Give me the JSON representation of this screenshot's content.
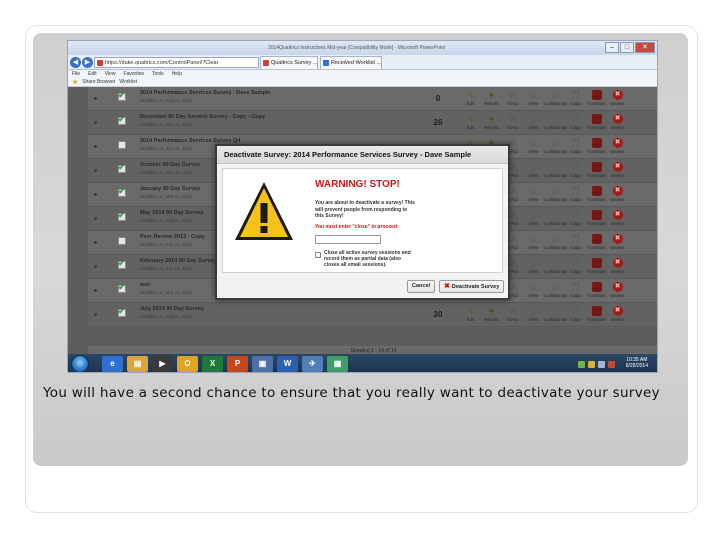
{
  "browser": {
    "window_title": "2014Qualtrics Instructions Mid-year [Compatibility Mode] - Microsoft PowerPoint",
    "address": "https://duke.qualtrics.com/ControlPanel/?Clear",
    "tabs": [
      "Qualtrics Survey ...",
      "Received Worklist ..."
    ],
    "menu": [
      "File",
      "Edit",
      "View",
      "Favorites",
      "Tools",
      "Help"
    ],
    "favorites": [
      "Share Browser",
      "Worklist"
    ]
  },
  "surveys": [
    {
      "name": "2014 Performance Services Survey - Dave Sample",
      "sub": "Modified on: Aug 01, 2014",
      "count": "0",
      "checked": true
    },
    {
      "name": "December 90 Day Generic Survey - Copy - Copy",
      "sub": "Modified on: Mar 11, 2014",
      "count": "26",
      "checked": true
    },
    {
      "name": "2014 Performance Services Survey Q4",
      "sub": "Modified on: Jan 09, 2014",
      "count": "",
      "checked": false
    },
    {
      "name": "October 90 Day Survey",
      "sub": "Modified on: Nov 10, 2013",
      "count": "",
      "checked": true
    },
    {
      "name": "January 90 Day Survey",
      "sub": "Modified on: Mar 07, 2014",
      "count": "",
      "checked": true
    },
    {
      "name": "May 2014 90 Day Survey",
      "sub": "Modified on: Aug 01, 2014",
      "count": "",
      "checked": true
    },
    {
      "name": "Peer Review 2013 - Copy",
      "sub": "Modified on: Feb 21, 2013",
      "count": "",
      "checked": false
    },
    {
      "name": "February 2014 90 Day Survey",
      "sub": "Modified on: Jun 19, 2014",
      "count": "",
      "checked": true
    },
    {
      "name": "test",
      "sub": "Modified on: Mar 17, 2013",
      "count": "",
      "checked": true
    },
    {
      "name": "July 2014 90 Day Survey",
      "sub": "Modified on: Aug 01, 2014",
      "count": "30",
      "checked": true
    }
  ],
  "actions": [
    {
      "label": "Edit",
      "glyph": "✎",
      "style": "olive"
    },
    {
      "label": "Results",
      "glyph": "✦",
      "style": "green"
    },
    {
      "label": "Send",
      "glyph": "✉",
      "style": "blue"
    },
    {
      "label": "View",
      "glyph": "⌕",
      "style": "blue"
    },
    {
      "label": "Collaborate",
      "glyph": "⚇",
      "style": "blue"
    },
    {
      "label": "Copy",
      "glyph": "❐",
      "style": "blue"
    },
    {
      "label": "Translate",
      "glyph": "",
      "style": "red"
    },
    {
      "label": "Delete",
      "glyph": "✖",
      "style": "redcircle"
    }
  ],
  "showing": "Showing 1 - 14 of 14",
  "modal": {
    "title": "Deactivate Survey: 2014 Performance Services Survey - Dave Sample",
    "warning": "WARNING! STOP!",
    "message": "You are about to deactivate a survey! This will prevent people from responding to this Survey!",
    "prompt": "You must enter \"close\" to proceed:",
    "input_value": "",
    "checkbox_label": "Close all active survey sessions and record them as partial data (also closes all email sessions).",
    "cancel_label": "Cancel",
    "deactivate_label": "Deactivate Survey"
  },
  "taskbar": {
    "apps": [
      {
        "label": "e",
        "color": "#2f6fd0"
      },
      {
        "label": "▤",
        "color": "#d9a63a"
      },
      {
        "label": "▶",
        "color": "#3a3a3a"
      },
      {
        "label": "O",
        "color": "#e0a51f"
      },
      {
        "label": "X",
        "color": "#1f7a3a"
      },
      {
        "label": "P",
        "color": "#c8461e"
      },
      {
        "label": "▣",
        "color": "#4f6fa8"
      },
      {
        "label": "W",
        "color": "#2b5fb4"
      },
      {
        "label": "✈",
        "color": "#4e7fb8"
      },
      {
        "label": "▦",
        "color": "#3f9f6a"
      }
    ],
    "time": "10:35 AM",
    "date": "8/28/2014"
  },
  "caption": "You will have a second chance to ensure that you really want to deactivate your survey"
}
